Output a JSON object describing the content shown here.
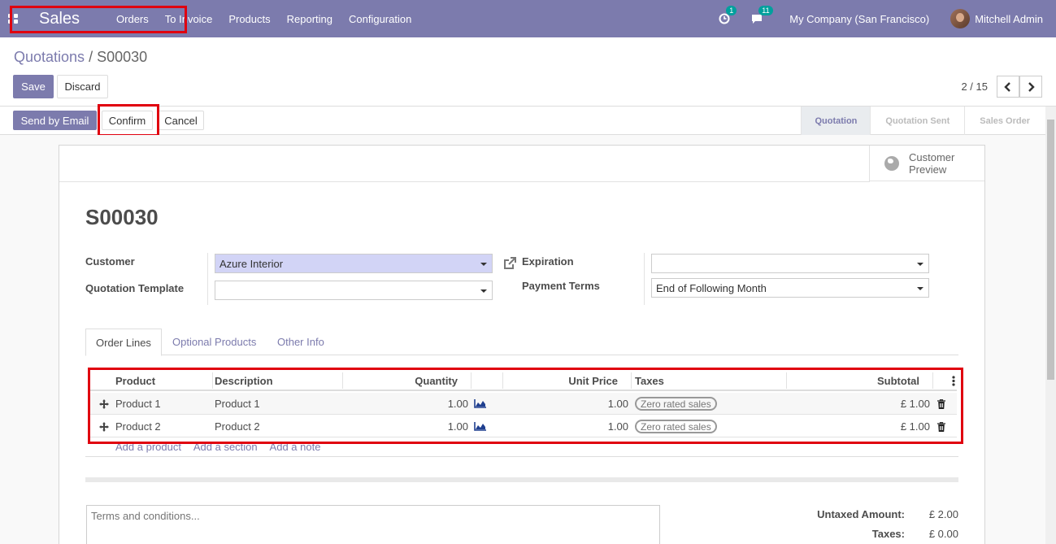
{
  "navbar": {
    "app_name": "Sales",
    "menu": [
      "Orders",
      "To Invoice",
      "Products",
      "Reporting",
      "Configuration"
    ],
    "activity_count": "1",
    "message_count": "11",
    "company": "My Company (San Francisco)",
    "user": "Mitchell Admin"
  },
  "breadcrumb": {
    "parent": "Quotations",
    "separator": "/",
    "current": "S00030"
  },
  "control": {
    "save_label": "Save",
    "discard_label": "Discard",
    "pager": "2 / 15",
    "prev_icon": "chevron-left-icon",
    "next_icon": "chevron-right-icon"
  },
  "status_buttons": {
    "send_email": "Send by Email",
    "confirm": "Confirm",
    "cancel": "Cancel"
  },
  "stages": [
    "Quotation",
    "Quotation Sent",
    "Sales Order"
  ],
  "active_stage": "Quotation",
  "sheet": {
    "customer_preview_line1": "Customer",
    "customer_preview_line2": "Preview",
    "title": "S00030"
  },
  "fields": {
    "customer_label": "Customer",
    "customer_value": "Azure Interior",
    "template_label": "Quotation Template",
    "template_value": "",
    "expiration_label": "Expiration",
    "expiration_value": "",
    "payment_terms_label": "Payment Terms",
    "payment_terms_value": "End of Following Month"
  },
  "tabs": [
    "Order Lines",
    "Optional Products",
    "Other Info"
  ],
  "order_lines": {
    "headers": [
      "Product",
      "Description",
      "Quantity",
      "Unit Price",
      "Taxes",
      "Subtotal"
    ],
    "rows": [
      {
        "product": "Product 1",
        "description": "Product 1",
        "quantity": "1.00",
        "unit_price": "1.00",
        "taxes": "Zero rated sales",
        "subtotal": "£ 1.00"
      },
      {
        "product": "Product 2",
        "description": "Product 2",
        "quantity": "1.00",
        "unit_price": "1.00",
        "taxes": "Zero rated sales",
        "subtotal": "£ 1.00"
      }
    ],
    "add_product": "Add a product",
    "add_section": "Add a section",
    "add_note": "Add a note"
  },
  "terms_placeholder": "Terms and conditions...",
  "totals": {
    "untaxed_label": "Untaxed Amount:",
    "untaxed_value": "£ 2.00",
    "taxes_label": "Taxes:",
    "taxes_value": "£ 0.00"
  },
  "colors": {
    "brand": "#7c7bad",
    "highlight": "#e0000f",
    "badge": "#00a09d"
  }
}
